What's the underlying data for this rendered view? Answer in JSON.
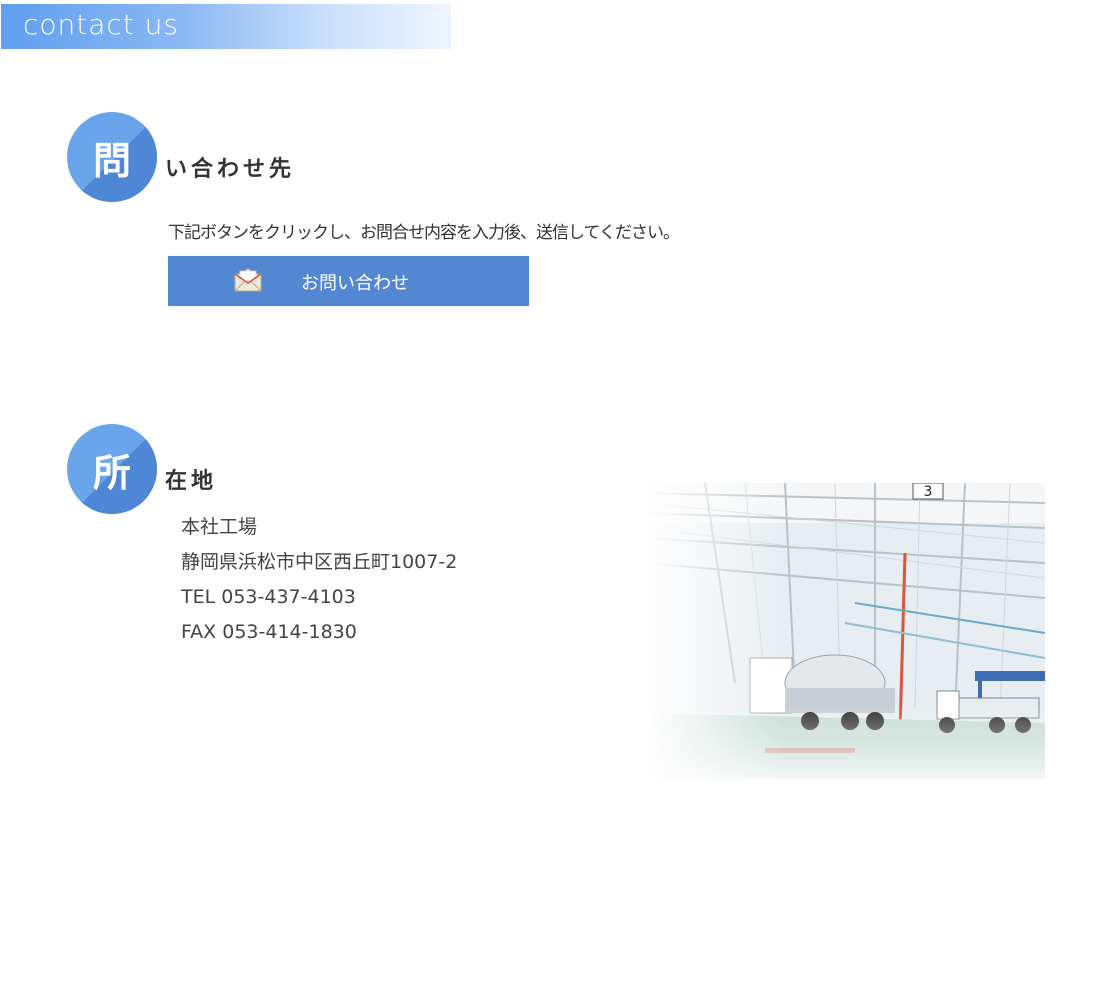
{
  "header": {
    "title": "contact us"
  },
  "inquiry": {
    "icon_char": "問",
    "title": "い合わせ先",
    "instruction": "下記ボタンをクリックし、お問合せ内容を入力後、送信してください。",
    "button_label": "お問い合わせ"
  },
  "location": {
    "icon_char": "所",
    "title": "在地",
    "lines": [
      "本社工場",
      "静岡県浜松市中区西丘町1007-2",
      "TEL 053-437-4103",
      "FAX 053-414-1830"
    ],
    "photo_bay_number": "3"
  },
  "colors": {
    "accent": "#5487d2",
    "circle": "#6aa5ec",
    "circle_shadow": "#4f86d6"
  },
  "icons": {
    "button_icon": "envelope-icon"
  }
}
